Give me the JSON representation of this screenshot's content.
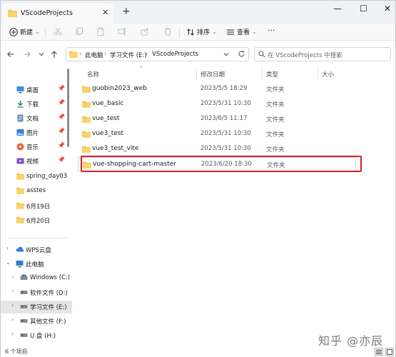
{
  "window": {
    "tab_title": "VScodeProjects",
    "new_tab": "+",
    "close_tab": "✕",
    "minimize": "—",
    "maximize": "☐",
    "close": "✕"
  },
  "commandbar": {
    "new_label": "新建",
    "new_caret": "⌄",
    "sort_label": "排序",
    "view_label": "查看",
    "more": "···"
  },
  "address": {
    "crumbs": [
      "此电脑",
      "学习文件 (E:)",
      "VScodeProjects"
    ],
    "crumb_sep": "›",
    "search_placeholder": "在 VScodeProjects 中搜索"
  },
  "sidebar": {
    "quick": [
      {
        "label": "桌面",
        "icon": "desktop-icon",
        "pinned": true
      },
      {
        "label": "下载",
        "icon": "download-icon",
        "pinned": true
      },
      {
        "label": "文档",
        "icon": "document-icon",
        "pinned": true
      },
      {
        "label": "图片",
        "icon": "picture-icon",
        "pinned": true
      },
      {
        "label": "音乐",
        "icon": "music-icon",
        "pinned": true
      },
      {
        "label": "视频",
        "icon": "video-icon",
        "pinned": true
      },
      {
        "label": "spring_day03",
        "icon": "folder-icon",
        "pinned": false
      },
      {
        "label": "asstes",
        "icon": "folder-icon",
        "pinned": false
      },
      {
        "label": "6月19日",
        "icon": "folder-icon",
        "pinned": false
      },
      {
        "label": "6月20日",
        "icon": "folder-icon",
        "pinned": false
      }
    ],
    "tree": [
      {
        "label": "WPS云盘",
        "icon": "cloud-icon",
        "expanded": false,
        "indent": 0
      },
      {
        "label": "此电脑",
        "icon": "computer-icon",
        "expanded": true,
        "indent": 0
      },
      {
        "label": "Windows (C:)",
        "icon": "drive-icon",
        "expanded": false,
        "indent": 1
      },
      {
        "label": "软件文件 (D:)",
        "icon": "drive-icon",
        "expanded": false,
        "indent": 1
      },
      {
        "label": "学习文件 (E:)",
        "icon": "drive-icon",
        "expanded": false,
        "indent": 1,
        "selected": true
      },
      {
        "label": "其他文件 (F:)",
        "icon": "drive-icon",
        "expanded": false,
        "indent": 1
      },
      {
        "label": "U 盘 (H:)",
        "icon": "usb-drive-icon",
        "expanded": false,
        "indent": 1
      }
    ]
  },
  "columns": {
    "name": "名称",
    "date": "修改日期",
    "type": "类型",
    "size": "大小",
    "sort_indicator": "^"
  },
  "files": [
    {
      "name": "guobin2023_web",
      "date": "2023/5/5 18:29",
      "type": "文件夹"
    },
    {
      "name": "vue_basic",
      "date": "2023/5/31 10:30",
      "type": "文件夹"
    },
    {
      "name": "vue_test",
      "date": "2023/6/5 11:17",
      "type": "文件夹"
    },
    {
      "name": "vue3_test",
      "date": "2023/5/31 10:30",
      "type": "文件夹"
    },
    {
      "name": "vue3_test_vite",
      "date": "2023/5/31 10:30",
      "type": "文件夹"
    },
    {
      "name": "vue-shopping-cart-master",
      "date": "2023/6/20 18:30",
      "type": "文件夹",
      "highlighted": true
    }
  ],
  "status": {
    "item_count": "6 个项目"
  },
  "watermark": "知乎 @亦辰",
  "colors": {
    "accent": "#0067c0",
    "folder": "#f4c64a",
    "highlight_box": "#d4202a",
    "selected_bg": "#e5e5e5"
  }
}
